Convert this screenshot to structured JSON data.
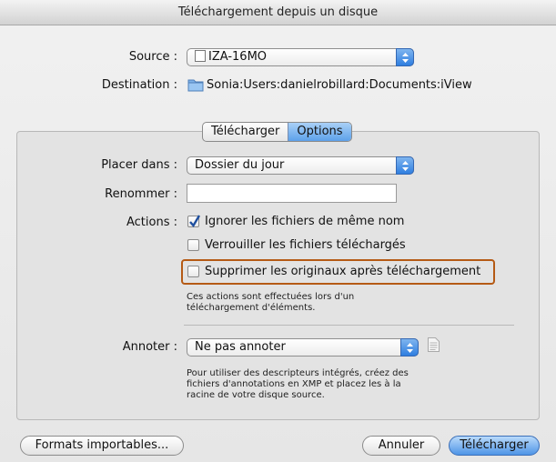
{
  "window": {
    "title": "Téléchargement depuis un disque"
  },
  "source": {
    "label": "Source :",
    "value": "IZA-16MO"
  },
  "destination": {
    "label": "Destination :",
    "value": "Sonia:Users:danielrobillard:Documents:iView"
  },
  "tabs": [
    {
      "label": "Télécharger",
      "selected": false
    },
    {
      "label": "Options",
      "selected": true
    }
  ],
  "options": {
    "place_label": "Placer dans :",
    "place_value": "Dossier du jour",
    "rename_label": "Renommer :",
    "rename_value": "",
    "actions_label": "Actions :",
    "actions": [
      {
        "label": "Ignorer les fichiers de même nom",
        "checked": true
      },
      {
        "label": "Verrouiller les fichiers téléchargés",
        "checked": false
      },
      {
        "label": "Supprimer les originaux après téléchargement",
        "checked": false
      }
    ],
    "actions_note": [
      "Ces actions sont effectuées lors d'un",
      "téléchargement d'éléments."
    ],
    "annotate_label": "Annoter :",
    "annotate_value": "Ne pas annoter",
    "annotate_note": [
      "Pour utiliser des descripteurs intégrés, créez des",
      "fichiers d'annotations en XMP et placez les à la",
      "racine de votre disque source."
    ]
  },
  "buttons": {
    "formats": "Formats importables...",
    "cancel": "Annuler",
    "download": "Télécharger"
  },
  "colors": {
    "highlight": "#b55a15",
    "accent": "#4e94e6"
  }
}
